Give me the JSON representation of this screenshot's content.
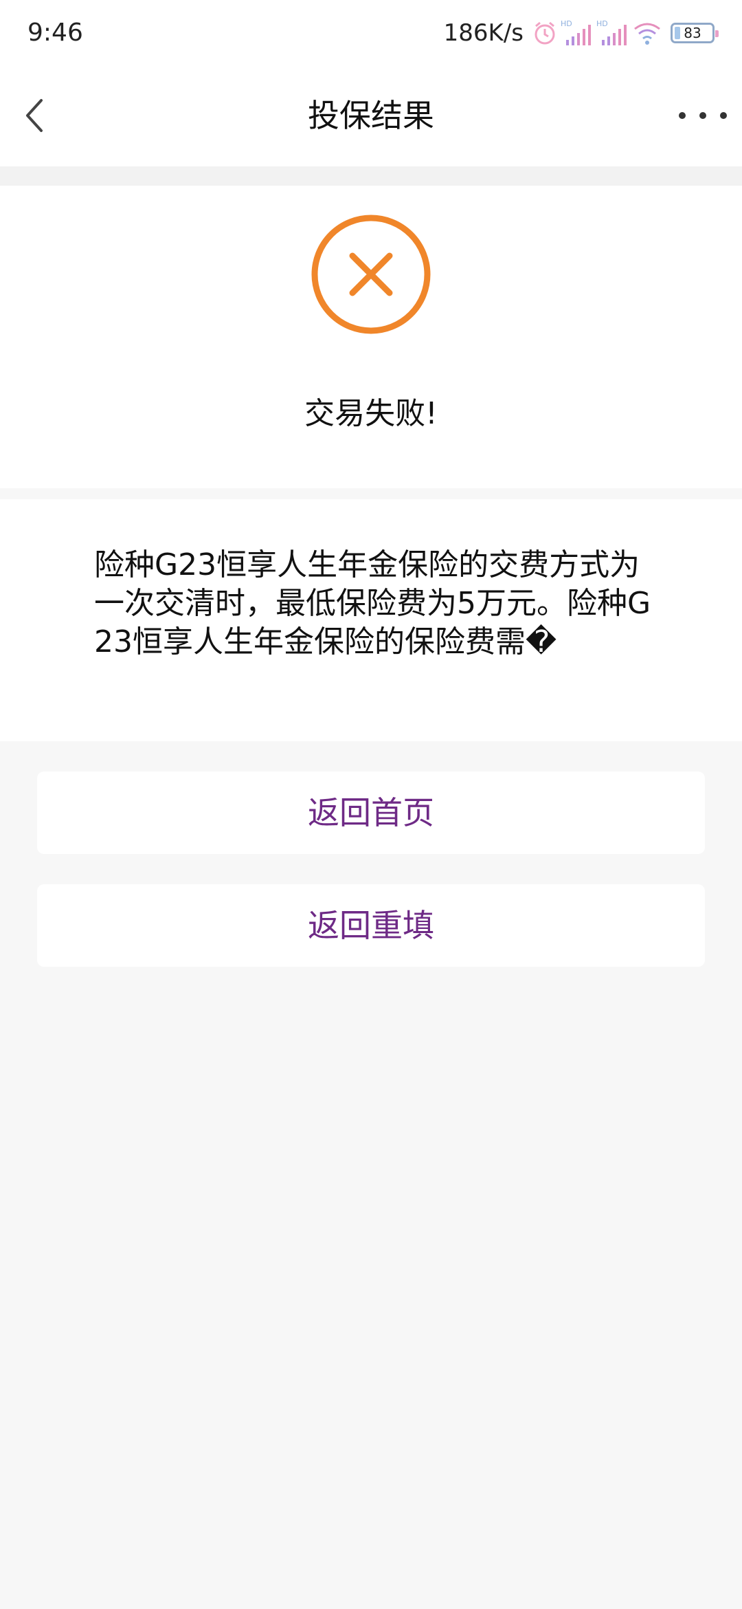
{
  "status_bar": {
    "time": "9:46",
    "net_speed": "186K/s",
    "battery_level": "83",
    "icons": [
      "alarm-icon",
      "hd-signal-icon",
      "hd-signal-icon",
      "wifi-icon",
      "battery-icon"
    ]
  },
  "nav": {
    "title": "投保结果",
    "back_icon": "chevron-left-icon",
    "more_icon": "more-dots-icon"
  },
  "result": {
    "icon": "fail-circle-x-icon",
    "status_text": "交易失败!",
    "accent_color": "#f0862a"
  },
  "message": {
    "text": "险种G23恒享人生年金保险的交费方式为一次交清时，最低保险费为5万元。险种G23恒享人生年金保险的保险费需�"
  },
  "actions": {
    "home_label": "返回首页",
    "refill_label": "返回重填",
    "label_color": "#6e2a86"
  }
}
